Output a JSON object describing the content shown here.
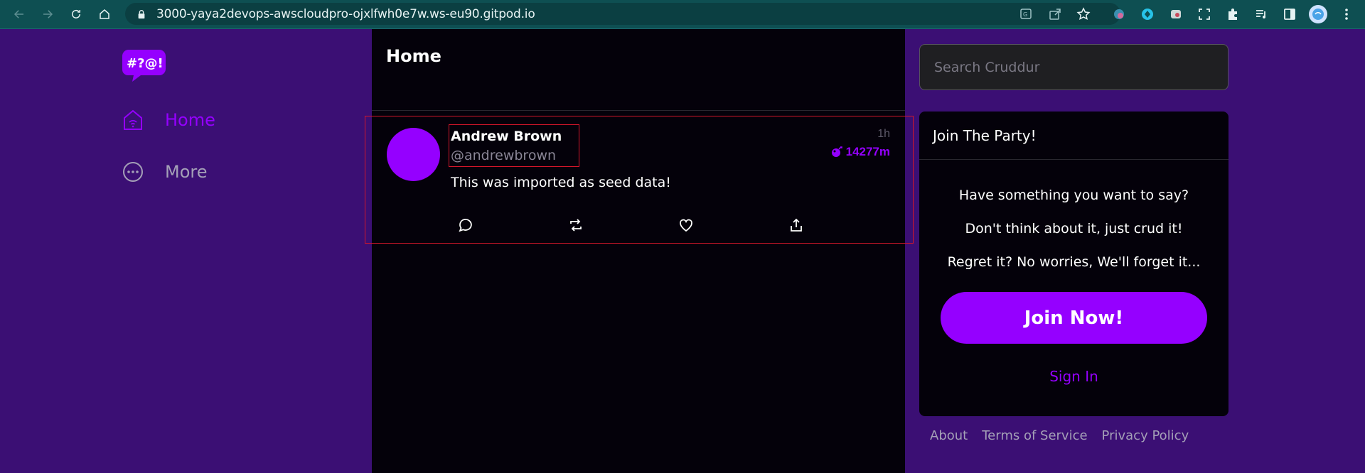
{
  "browser": {
    "url": "3000-yaya2devops-awscloudpro-ojxlfwh0e7w.ws-eu90.gitpod.io",
    "colors": {
      "toolbar": "#0e4f52"
    }
  },
  "nav": {
    "logo_text": "#?@!",
    "items": [
      {
        "label": "Home",
        "icon": "home-icon",
        "active": true
      },
      {
        "label": "More",
        "icon": "more-icon",
        "active": false
      }
    ]
  },
  "feed": {
    "title": "Home",
    "activity": {
      "display_name": "Andrew Brown",
      "handle": "@andrewbrown",
      "time_ago": "1h",
      "expires": "14277m",
      "message": "This was imported as seed data!",
      "actions": [
        "reply-icon",
        "repost-icon",
        "like-icon",
        "share-icon"
      ]
    }
  },
  "sidebar": {
    "search_placeholder": "Search Cruddur",
    "join": {
      "header": "Join The Party!",
      "lines": [
        "Have something you want to say?",
        "Don't think about it, just crud it!",
        "Regret it? No worries, We'll forget it..."
      ],
      "join_button": "Join Now!",
      "sign_in": "Sign In"
    },
    "footer_links": [
      "About",
      "Terms of Service",
      "Privacy Policy"
    ]
  },
  "colors": {
    "page_bg": "#3b0f74",
    "accent": "#9500ff",
    "panel_bg": "#04010a",
    "highlight_border": "#d3162a"
  }
}
